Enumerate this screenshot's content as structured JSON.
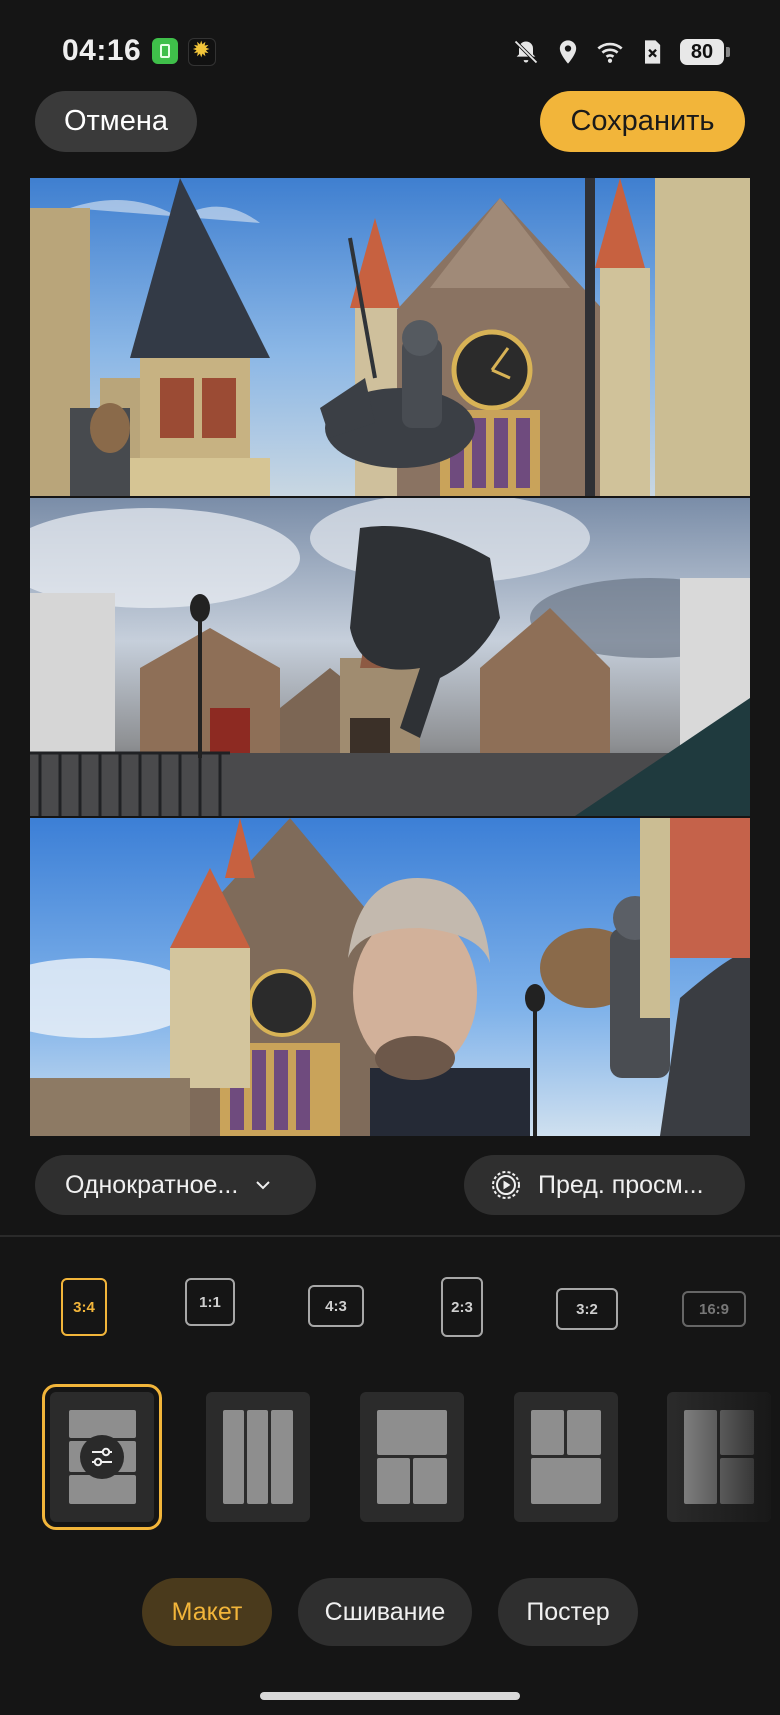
{
  "status_bar": {
    "time": "04:16",
    "battery": "80"
  },
  "header": {
    "cancel_label": "Отмена",
    "save_label": "Сохранить"
  },
  "controls": {
    "mode_label": "Однократное...",
    "preview_label": "Пред. просм..."
  },
  "ratios": [
    {
      "label": "3:4",
      "selected": true
    },
    {
      "label": "1:1",
      "selected": false
    },
    {
      "label": "4:3",
      "selected": false
    },
    {
      "label": "2:3",
      "selected": false
    },
    {
      "label": "3:2",
      "selected": false
    },
    {
      "label": "16:9",
      "selected": false
    }
  ],
  "tabs": [
    {
      "label": "Макет",
      "selected": true
    },
    {
      "label": "Сшивание",
      "selected": false
    },
    {
      "label": "Постер",
      "selected": false
    }
  ],
  "colors": {
    "accent": "#f2b53a",
    "background": "#151515",
    "pill": "#2f2f2f"
  }
}
